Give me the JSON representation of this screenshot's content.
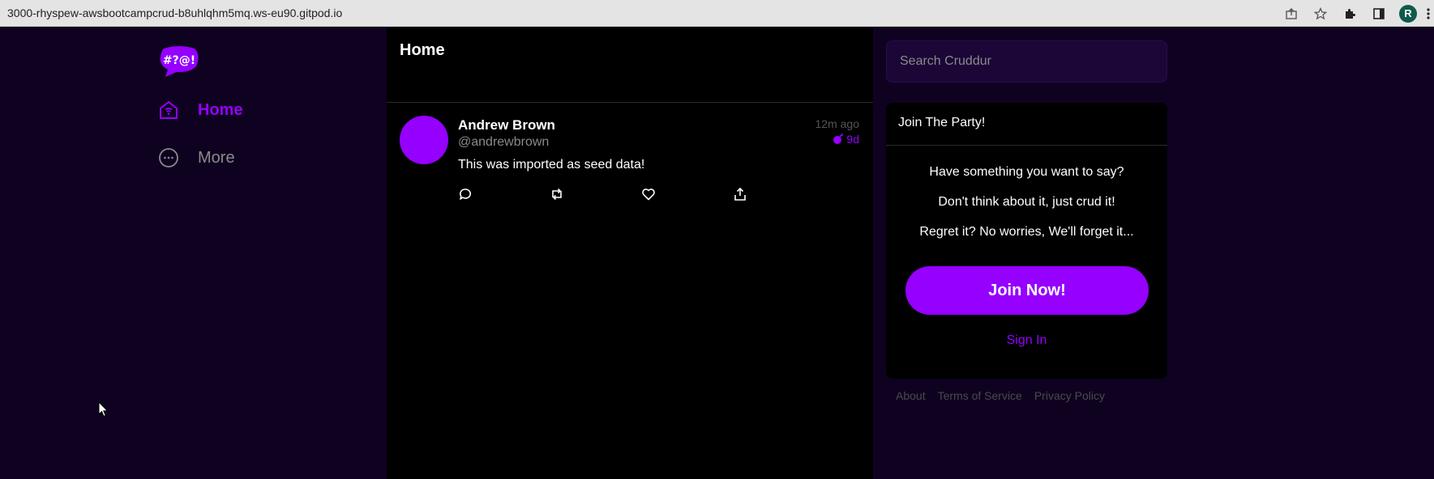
{
  "browser": {
    "url": "3000-rhyspew-awsbootcampcrud-b8uhlqhm5mq.ws-eu90.gitpod.io",
    "profile_initial": "R"
  },
  "sidebar": {
    "logo_text": "#?@!",
    "items": [
      {
        "label": "Home",
        "icon": "home-icon",
        "active": true
      },
      {
        "label": "More",
        "icon": "more-icon",
        "active": false
      }
    ]
  },
  "feed": {
    "title": "Home",
    "activities": [
      {
        "display_name": "Andrew Brown",
        "handle": "@andrewbrown",
        "time_ago": "12m ago",
        "expires": "9d",
        "message": "This was imported as seed data!"
      }
    ]
  },
  "search": {
    "placeholder": "Search Cruddur"
  },
  "join": {
    "title": "Join The Party!",
    "lines": [
      "Have something you want to say?",
      "Don't think about it, just crud it!",
      "Regret it? No worries, We'll forget it..."
    ],
    "button_label": "Join Now!",
    "sign_in_label": "Sign In"
  },
  "footer": {
    "links": [
      "About",
      "Terms of Service",
      "Privacy Policy"
    ]
  },
  "colors": {
    "accent": "#9500ff",
    "background": "#0f0221",
    "feed_background": "#000000"
  }
}
